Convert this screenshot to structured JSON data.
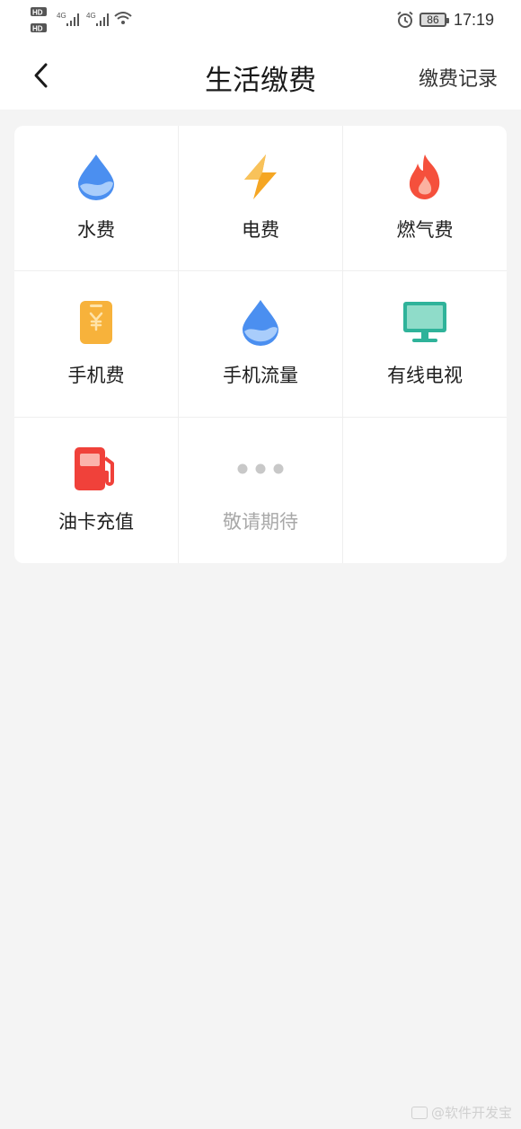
{
  "status_bar": {
    "time": "17:19",
    "battery": "86",
    "network_1": "4G",
    "network_2": "4G",
    "sim_1": "HD",
    "sim_2": "HD"
  },
  "navbar": {
    "title": "生活缴费",
    "right_action": "缴费记录"
  },
  "services": [
    {
      "label": "水费",
      "icon": "water-drop-icon",
      "color": "#4b8ff0"
    },
    {
      "label": "电费",
      "icon": "lightning-icon",
      "color": "#f5a623"
    },
    {
      "label": "燃气费",
      "icon": "flame-icon",
      "color": "#f5503c"
    },
    {
      "label": "手机费",
      "icon": "phone-yuan-icon",
      "color": "#f7b23b"
    },
    {
      "label": "手机流量",
      "icon": "water-drop-icon",
      "color": "#4b8ff0"
    },
    {
      "label": "有线电视",
      "icon": "monitor-icon",
      "color": "#2fb39a"
    },
    {
      "label": "油卡充值",
      "icon": "fuel-pump-icon",
      "color": "#f0413a"
    },
    {
      "label": "敬请期待",
      "icon": "more-dots-icon",
      "color": "#c8c8c8"
    }
  ],
  "watermark": "@软件开发宝"
}
